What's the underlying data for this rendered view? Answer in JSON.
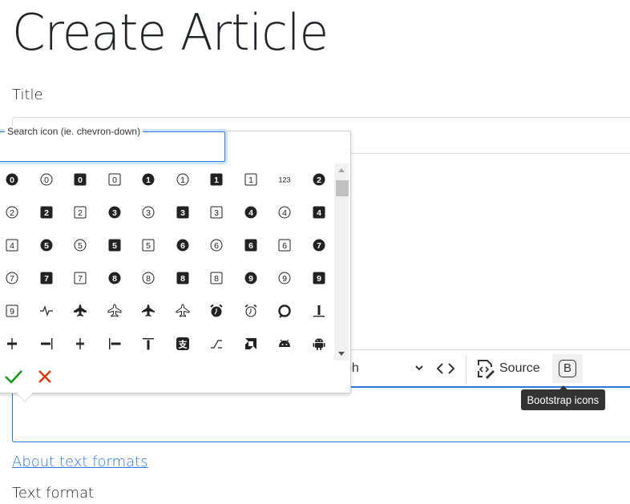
{
  "page": {
    "title": "Create Article",
    "title_field_label": "Title",
    "about_link": "About text formats",
    "text_format_label": "Text format"
  },
  "toolbar": {
    "heading_value": "Paragraph",
    "heading_visible": "ph",
    "code_label": "<>",
    "source_label": "Source",
    "bootstrap_button_label": "B",
    "tooltip": "Bootstrap icons"
  },
  "colors": {
    "accent": "#2977e2",
    "confirm": "#1a9a1a",
    "cancel": "#d83a0f",
    "tooltip_bg": "#333333"
  },
  "icon_picker": {
    "search_label": "Search icon (ie. chevron-down)",
    "search_value": "",
    "confirm_icon": "check-icon",
    "cancel_icon": "x-icon",
    "icons": [
      {
        "name": "0-circle-fill",
        "type": "num",
        "glyph": "0",
        "shape": "circle",
        "fill": true
      },
      {
        "name": "0-circle",
        "type": "num",
        "glyph": "0",
        "shape": "circle",
        "fill": false
      },
      {
        "name": "0-square-fill",
        "type": "num",
        "glyph": "0",
        "shape": "square",
        "fill": true
      },
      {
        "name": "0-square",
        "type": "num",
        "glyph": "0",
        "shape": "square",
        "fill": false
      },
      {
        "name": "1-circle-fill",
        "type": "num",
        "glyph": "1",
        "shape": "circle",
        "fill": true
      },
      {
        "name": "1-circle",
        "type": "num",
        "glyph": "1",
        "shape": "circle",
        "fill": false
      },
      {
        "name": "1-square-fill",
        "type": "num",
        "glyph": "1",
        "shape": "square",
        "fill": true
      },
      {
        "name": "1-square",
        "type": "num",
        "glyph": "1",
        "shape": "square",
        "fill": false
      },
      {
        "name": "123",
        "type": "text",
        "glyph": "123"
      },
      {
        "name": "2-circle-fill",
        "type": "num",
        "glyph": "2",
        "shape": "circle",
        "fill": true
      },
      {
        "name": "2-circle",
        "type": "num",
        "glyph": "2",
        "shape": "circle",
        "fill": false
      },
      {
        "name": "2-square-fill",
        "type": "num",
        "glyph": "2",
        "shape": "square",
        "fill": true
      },
      {
        "name": "2-square",
        "type": "num",
        "glyph": "2",
        "shape": "square",
        "fill": false
      },
      {
        "name": "3-circle-fill",
        "type": "num",
        "glyph": "3",
        "shape": "circle",
        "fill": true
      },
      {
        "name": "3-circle",
        "type": "num",
        "glyph": "3",
        "shape": "circle",
        "fill": false
      },
      {
        "name": "3-square-fill",
        "type": "num",
        "glyph": "3",
        "shape": "square",
        "fill": true
      },
      {
        "name": "3-square",
        "type": "num",
        "glyph": "3",
        "shape": "square",
        "fill": false
      },
      {
        "name": "4-circle-fill",
        "type": "num",
        "glyph": "4",
        "shape": "circle",
        "fill": true
      },
      {
        "name": "4-circle",
        "type": "num",
        "glyph": "4",
        "shape": "circle",
        "fill": false
      },
      {
        "name": "4-square-fill",
        "type": "num",
        "glyph": "4",
        "shape": "square",
        "fill": true
      },
      {
        "name": "4-square",
        "type": "num",
        "glyph": "4",
        "shape": "square",
        "fill": false
      },
      {
        "name": "5-circle-fill",
        "type": "num",
        "glyph": "5",
        "shape": "circle",
        "fill": true
      },
      {
        "name": "5-circle",
        "type": "num",
        "glyph": "5",
        "shape": "circle",
        "fill": false
      },
      {
        "name": "5-square-fill",
        "type": "num",
        "glyph": "5",
        "shape": "square",
        "fill": true
      },
      {
        "name": "5-square",
        "type": "num",
        "glyph": "5",
        "shape": "square",
        "fill": false
      },
      {
        "name": "6-circle-fill",
        "type": "num",
        "glyph": "6",
        "shape": "circle",
        "fill": true
      },
      {
        "name": "6-circle",
        "type": "num",
        "glyph": "6",
        "shape": "circle",
        "fill": false
      },
      {
        "name": "6-square-fill",
        "type": "num",
        "glyph": "6",
        "shape": "square",
        "fill": true
      },
      {
        "name": "6-square",
        "type": "num",
        "glyph": "6",
        "shape": "square",
        "fill": false
      },
      {
        "name": "7-circle-fill",
        "type": "num",
        "glyph": "7",
        "shape": "circle",
        "fill": true
      },
      {
        "name": "7-circle",
        "type": "num",
        "glyph": "7",
        "shape": "circle",
        "fill": false
      },
      {
        "name": "7-square-fill",
        "type": "num",
        "glyph": "7",
        "shape": "square",
        "fill": true
      },
      {
        "name": "7-square",
        "type": "num",
        "glyph": "7",
        "shape": "square",
        "fill": false
      },
      {
        "name": "8-circle-fill",
        "type": "num",
        "glyph": "8",
        "shape": "circle",
        "fill": true
      },
      {
        "name": "8-circle",
        "type": "num",
        "glyph": "8",
        "shape": "circle",
        "fill": false
      },
      {
        "name": "8-square-fill",
        "type": "num",
        "glyph": "8",
        "shape": "square",
        "fill": true
      },
      {
        "name": "8-square",
        "type": "num",
        "glyph": "8",
        "shape": "square",
        "fill": false
      },
      {
        "name": "9-circle-fill",
        "type": "num",
        "glyph": "9",
        "shape": "circle",
        "fill": true
      },
      {
        "name": "9-circle",
        "type": "num",
        "glyph": "9",
        "shape": "circle",
        "fill": false
      },
      {
        "name": "9-square-fill",
        "type": "num",
        "glyph": "9",
        "shape": "square",
        "fill": true
      },
      {
        "name": "9-square",
        "type": "num",
        "glyph": "9",
        "shape": "square",
        "fill": false
      },
      {
        "name": "activity",
        "type": "svg",
        "glyph": "activity"
      },
      {
        "name": "airplane-engines-fill",
        "type": "svg",
        "glyph": "airplane-engines-fill"
      },
      {
        "name": "airplane-engines",
        "type": "svg",
        "glyph": "airplane-engines"
      },
      {
        "name": "airplane-fill",
        "type": "svg",
        "glyph": "airplane-fill"
      },
      {
        "name": "airplane",
        "type": "svg",
        "glyph": "airplane"
      },
      {
        "name": "alarm-fill",
        "type": "svg",
        "glyph": "alarm-fill"
      },
      {
        "name": "alarm",
        "type": "svg",
        "glyph": "alarm"
      },
      {
        "name": "alexa",
        "type": "svg",
        "glyph": "alexa"
      },
      {
        "name": "align-bottom",
        "type": "svg",
        "glyph": "align-bottom"
      },
      {
        "name": "align-center",
        "type": "svg",
        "glyph": "align-center"
      },
      {
        "name": "align-end",
        "type": "svg",
        "glyph": "align-end"
      },
      {
        "name": "align-middle",
        "type": "svg",
        "glyph": "align-middle"
      },
      {
        "name": "align-start",
        "type": "svg",
        "glyph": "align-start"
      },
      {
        "name": "align-top",
        "type": "svg",
        "glyph": "align-top"
      },
      {
        "name": "alipay",
        "type": "svg",
        "glyph": "alipay"
      },
      {
        "name": "alt",
        "type": "svg",
        "glyph": "alt"
      },
      {
        "name": "amd",
        "type": "svg",
        "glyph": "amd"
      },
      {
        "name": "android",
        "type": "svg",
        "glyph": "android"
      },
      {
        "name": "android2",
        "type": "svg",
        "glyph": "android2"
      }
    ]
  }
}
